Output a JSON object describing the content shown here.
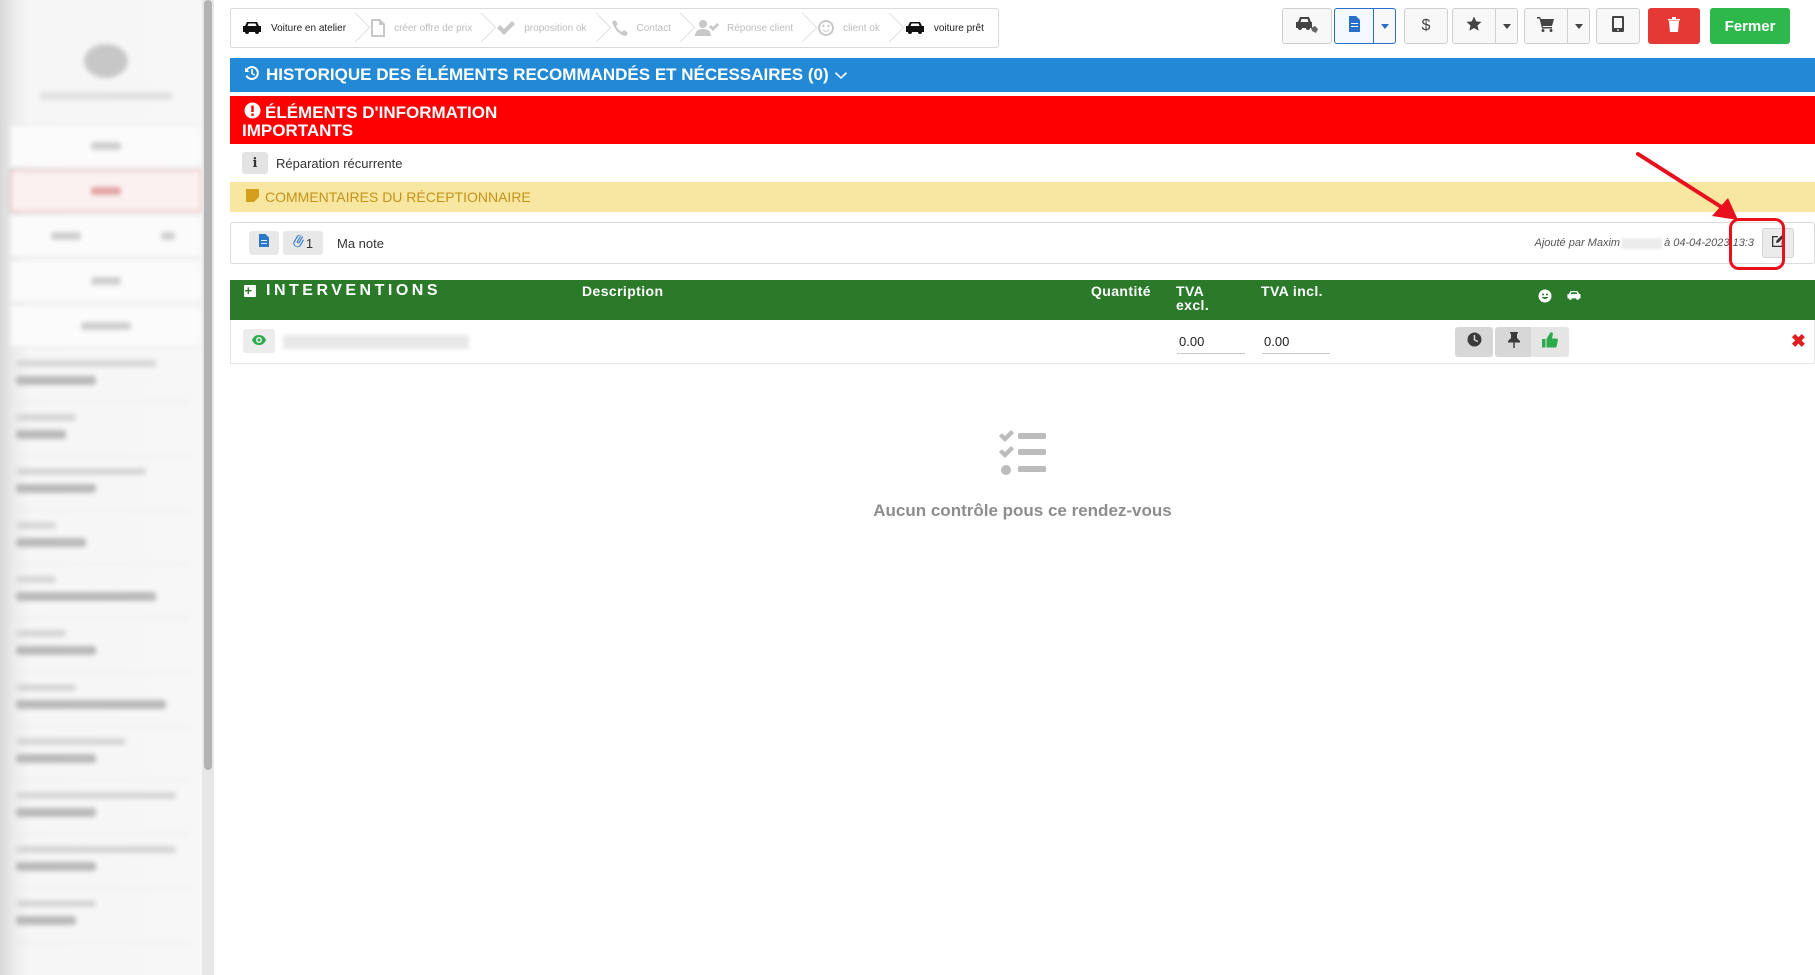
{
  "workflow_steps": [
    {
      "label": "Voiture en atelier",
      "icon": "car-icon",
      "state": "done"
    },
    {
      "label": "créer offre de prix",
      "icon": "document-icon",
      "state": "pending"
    },
    {
      "label": "proposition ok",
      "icon": "check-icon",
      "state": "pending"
    },
    {
      "label": "Contact",
      "icon": "phone-icon",
      "state": "pending"
    },
    {
      "label": "Réponse client",
      "icon": "user-check-icon",
      "state": "pending"
    },
    {
      "label": "client ok",
      "icon": "smile-icon",
      "state": "pending"
    },
    {
      "label": "voiture prêt",
      "icon": "car-icon",
      "state": "done"
    }
  ],
  "toolbar": {
    "close_label": "Fermer",
    "dollar_label": "$",
    "colors": {
      "primary": "#2a6fc9",
      "danger": "#e53935",
      "success": "#2eb84c"
    }
  },
  "sections": {
    "history_title": "HISTORIQUE DES ÉLÉMENTS RECOMMANDÉS ET NÉCESSAIRES (0)",
    "important_title_line1": "ÉLÉMENTS D'INFORMATION",
    "important_title_line2": "IMPORTANTS",
    "info_badge": "i",
    "info_text": "Réparation récurrente",
    "comments_title": "COMMENTAIRES DU RÉCEPTIONNAIRE",
    "colors": {
      "history": "#2289d6",
      "important": "#ff0000",
      "comments_bg": "#f8e7a1",
      "interventions": "#2a7a2a"
    }
  },
  "note": {
    "attachment_count": "1",
    "text": "Ma note",
    "meta_prefix": "Ajouté par Maxim",
    "meta_suffix": "à 04-04-2023 13:3"
  },
  "interventions": {
    "title": "INTERVENTIONS",
    "plus_label": "+",
    "columns": {
      "description": "Description",
      "quantity": "Quantité",
      "tva_excl_1": "TVA",
      "tva_excl_2": "excl.",
      "tva_incl": "TVA incl."
    },
    "rows": [
      {
        "tva_excl": "0.00",
        "tva_incl": "0.00"
      }
    ],
    "delete_label": "✖"
  },
  "empty_state": {
    "message": "Aucun contrôle pous ce rendez-vous"
  }
}
